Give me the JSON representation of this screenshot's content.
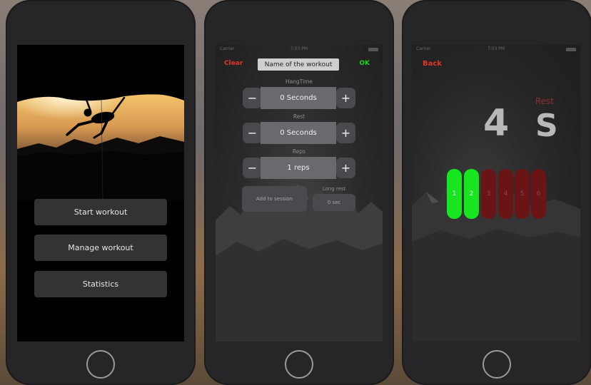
{
  "phone1": {
    "menu": [
      {
        "label": "Start workout"
      },
      {
        "label": "Manage workout"
      },
      {
        "label": "Statistics"
      }
    ]
  },
  "phone2": {
    "status": {
      "carrier": "Carrier",
      "time": "7:03 PM"
    },
    "clear_label": "Clear",
    "name_value": "Name of the workout",
    "ok_label": "OK",
    "steppers": [
      {
        "title": "HangTime",
        "value": "0 Seconds"
      },
      {
        "title": "Rest",
        "value": "0 Seconds"
      },
      {
        "title": "Reps",
        "value": "1 reps"
      }
    ],
    "minus_symbol": "−",
    "plus_symbol": "+",
    "add_session_label": "Add to session",
    "long_rest_label": "Long rest",
    "long_rest_value": "0 sec"
  },
  "phone3": {
    "status": {
      "carrier": "Carrier",
      "time": "7:03 PM"
    },
    "back_label": "Back",
    "phase_label": "Rest",
    "count": "4",
    "unit": "S",
    "reps": [
      {
        "n": "1",
        "done": true
      },
      {
        "n": "2",
        "done": true
      },
      {
        "n": "3",
        "done": false
      },
      {
        "n": "4",
        "done": false
      },
      {
        "n": "5",
        "done": false
      },
      {
        "n": "6",
        "done": false
      }
    ]
  },
  "colors": {
    "accent_red": "#e0362c",
    "accent_green": "#1bd61b",
    "rep_done": "#16e51f",
    "rep_pending": "#6a1515"
  }
}
